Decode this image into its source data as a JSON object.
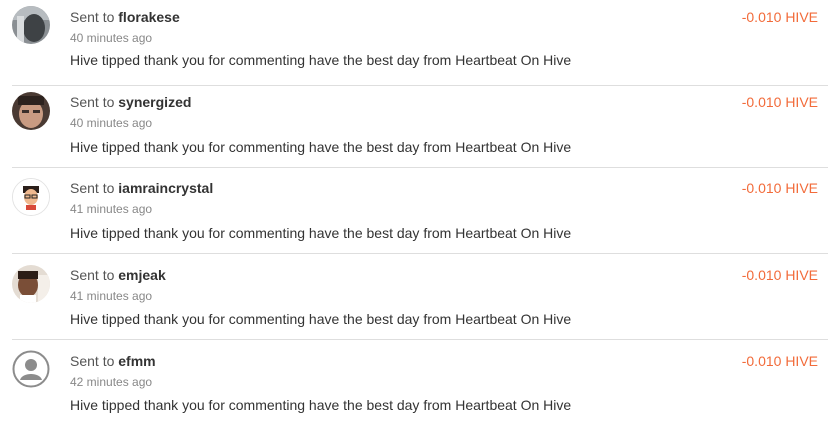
{
  "transfers": [
    {
      "prefix": "Sent to ",
      "user": "florakese",
      "time": "40 minutes ago",
      "memo": "Hive tipped thank you for commenting have the best day from Heartbeat On Hive",
      "amount": "-0.010 HIVE"
    },
    {
      "prefix": "Sent to ",
      "user": "synergized",
      "time": "40 minutes ago",
      "memo": "Hive tipped thank you for commenting have the best day from Heartbeat On Hive",
      "amount": "-0.010 HIVE"
    },
    {
      "prefix": "Sent to ",
      "user": "iamraincrystal",
      "time": "41 minutes ago",
      "memo": "Hive tipped thank you for commenting have the best day from Heartbeat On Hive",
      "amount": "-0.010 HIVE"
    },
    {
      "prefix": "Sent to ",
      "user": "emjeak",
      "time": "41 minutes ago",
      "memo": "Hive tipped thank you for commenting have the best day from Heartbeat On Hive",
      "amount": "-0.010 HIVE"
    },
    {
      "prefix": "Sent to ",
      "user": "efmm",
      "time": "42 minutes ago",
      "memo": "Hive tipped thank you for commenting have the best day from Heartbeat On Hive",
      "amount": "-0.010 HIVE"
    }
  ],
  "colors": {
    "amount": "#f26b3a",
    "divider": "#dedede"
  },
  "icons": {
    "default_avatar": "user-placeholder-icon"
  }
}
